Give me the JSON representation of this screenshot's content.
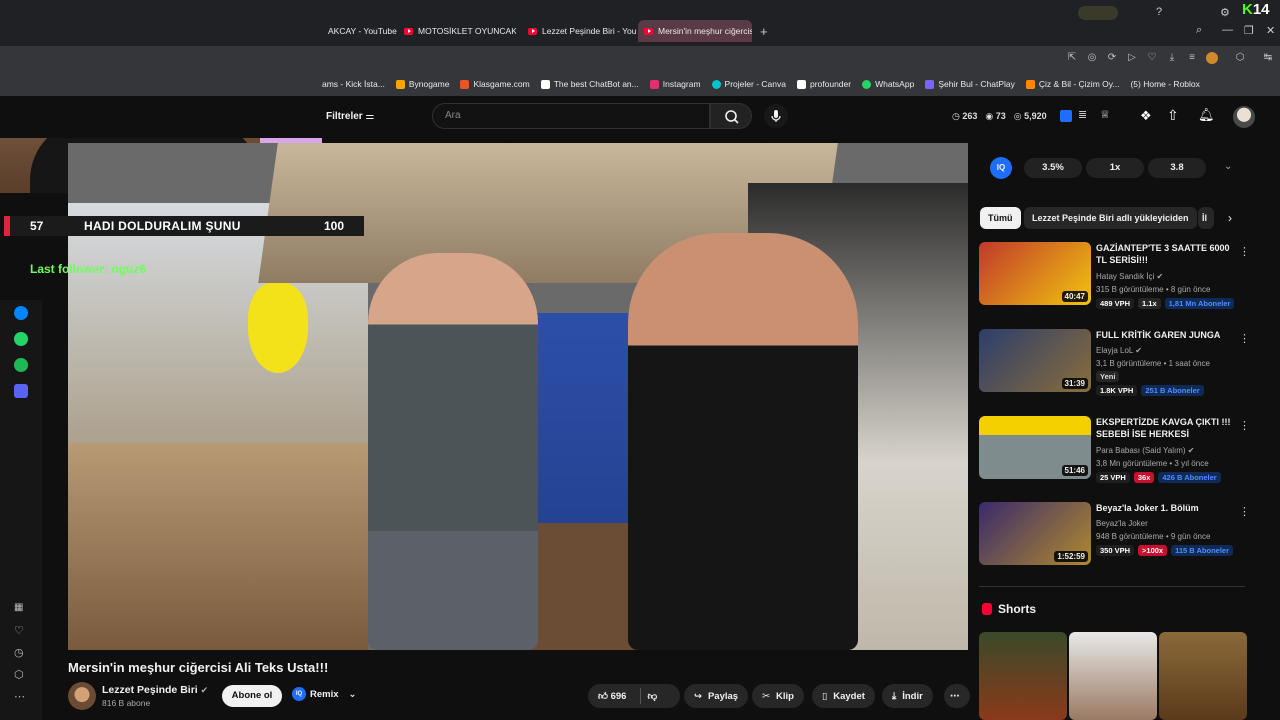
{
  "browser": {
    "tabs": [
      {
        "title": "AKCAY - YouTube",
        "active": false
      },
      {
        "title": "MOTOSİKLET OYUNCAK D",
        "active": false
      },
      {
        "title": "Lezzet Peşinde Biri - YouTu",
        "active": false
      },
      {
        "title": "Mersin'in meşhur ciğercis",
        "active": true
      }
    ],
    "new_tab": "+",
    "corner_badge_letter": "K",
    "corner_badge_number": "14",
    "bookmarks": [
      {
        "label": "ams - Kick İsta...",
        "color": "#53fc18"
      },
      {
        "label": "Bynogame",
        "color": "#f2a900"
      },
      {
        "label": "Klasgame.com",
        "color": "#e8552d"
      },
      {
        "label": "The best ChatBot an...",
        "color": "#ffffff"
      },
      {
        "label": "Instagram",
        "color": "#e1306c"
      },
      {
        "label": "Projeler - Canva",
        "color": "#00c4cc"
      },
      {
        "label": "profounder",
        "color": "#ffffff"
      },
      {
        "label": "WhatsApp",
        "color": "#25d366"
      },
      {
        "label": "Şehir Bul - ChatPlay",
        "color": "#7b61ff"
      },
      {
        "label": "Çiz & Bil - Çizim Oy...",
        "color": "#ff8a00"
      },
      {
        "label": "(5) Home - Roblox",
        "color": "#cccccc"
      }
    ]
  },
  "header": {
    "filters_label": "Filtreler",
    "search_placeholder": "Ara",
    "stats": [
      "263",
      "73",
      "5,920"
    ]
  },
  "overlay": {
    "goal_current": "57",
    "goal_title": "HADI DOLDURALIM ŞUNU",
    "goal_target": "100",
    "last_follower": "Last follower: oguz6"
  },
  "video": {
    "title": "Mersin'in meşhur ciğercisi Ali Teks Usta!!!",
    "channel": "Lezzet Peşinde Biri",
    "subscribers": "816 B abone",
    "subscribe_label": "Abone ol",
    "remix_label": "Remix",
    "likes": "696",
    "share_label": "Paylaş",
    "clip_label": "Klip",
    "save_label": "Kaydet",
    "download_label": "İndir"
  },
  "iq_bar": {
    "logo": "IQ",
    "values": [
      "3.5%",
      "1x",
      "3.8"
    ]
  },
  "chips": [
    "Tümü",
    "Lezzet Peşinde Biri adlı yükleyiciden",
    "İl"
  ],
  "recommendations": [
    {
      "title": "GAZİANTEP'TE 3 SAATTE 6000 TL SERİSİ!!!",
      "channel": "Hatay Sandık İçi",
      "meta": "315 B görüntüleme • 8 gün önce",
      "duration": "40:47",
      "vph": "489 VPH",
      "mult": "1.1x",
      "subs": "1,81 Mn Aboneler",
      "thumb_color": "#c0392b"
    },
    {
      "title": "FULL KRİTİK GAREN JUNGA",
      "channel": "Elayja LoL",
      "meta": "3,1 B görüntüleme • 1 saat önce",
      "badge": "Yeni",
      "duration": "31:39",
      "vph": "1.8K VPH",
      "subs": "251 B Aboneler",
      "thumb_color": "#3b4a6b"
    },
    {
      "title": "EKSPERTİZDE KAVGA ÇIKTI !!! SEBEBİ İSE HERKESİ ŞAŞIRTT...",
      "channel": "Para Babası (Said Yalım)",
      "meta": "3,8 Mn görüntüleme • 3 yıl önce",
      "duration": "51:46",
      "vph": "25 VPH",
      "mult": "36x",
      "subs": "426 B Aboneler",
      "thumb_color": "#e5c400"
    },
    {
      "title": "Beyaz'la Joker 1. Bölüm",
      "channel": "Beyaz'la Joker",
      "meta": "948 B görüntüleme • 9 gün önce",
      "duration": "1:52:59",
      "vph": "350 VPH",
      "mult": ">100x",
      "subs": "115 B Aboneler",
      "thumb_color": "#3a2a6b"
    }
  ],
  "shorts_label": "Shorts",
  "colors": {
    "accent_red": "#ff0033",
    "kick_green": "#53fc18",
    "iq_blue": "#1f6dff"
  }
}
